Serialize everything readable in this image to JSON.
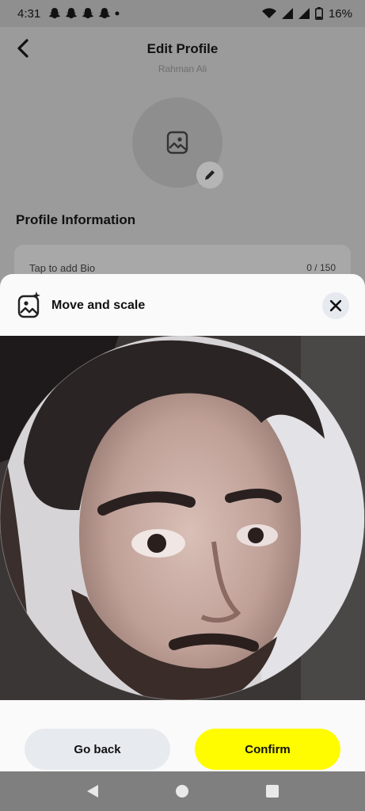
{
  "status_bar": {
    "time": "4:31",
    "battery": "16%"
  },
  "page": {
    "title": "Edit Profile",
    "subtitle": "Rahman Ali",
    "section_title": "Profile Information",
    "bio_placeholder": "Tap to add Bio",
    "bio_counter": "0 / 150"
  },
  "sheet": {
    "title": "Move and scale",
    "go_back_label": "Go back",
    "confirm_label": "Confirm"
  },
  "colors": {
    "confirm": "#fffc00",
    "go_back": "#e7ebef",
    "close_bg": "#e6e9ed"
  }
}
